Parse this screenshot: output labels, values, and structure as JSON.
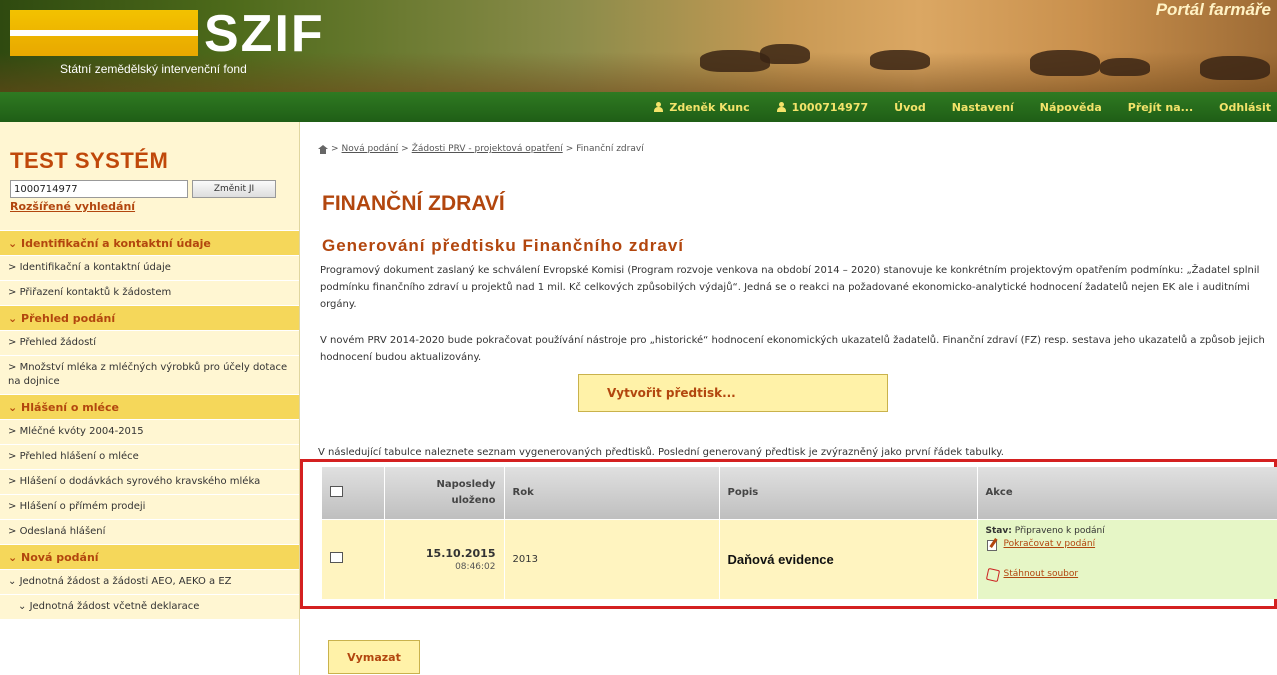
{
  "header": {
    "logo_text": "SZIF",
    "logo_subtitle": "Státní zemědělský intervenční fond",
    "portal_title": "Portál farmáře"
  },
  "topnav": {
    "user_name": "Zdeněk Kunc",
    "user_id": "1000714977",
    "home": "Úvod",
    "settings": "Nastavení",
    "help": "Nápověda",
    "goto": "Přejít na...",
    "logout": "Odhlásit"
  },
  "sidebar": {
    "title": "TEST SYSTÉM",
    "search_value": "1000714977",
    "search_button": "Změnit JI",
    "advanced_search": "Rozšířené vyhledání",
    "sections": [
      {
        "label": "Identifikační a kontaktní údaje",
        "items": [
          "Identifikační a kontaktní údaje",
          "Přiřazení kontaktů k žádostem"
        ]
      },
      {
        "label": "Přehled podání",
        "items": [
          "Přehled žádostí",
          "Množství mléka z mléčných výrobků pro účely dotace na dojnice"
        ]
      },
      {
        "label": "Hlášení o mléce",
        "items": [
          "Mléčné kvóty 2004-2015",
          "Přehled hlášení o mléce",
          "Hlášení o dodávkách syrového kravského mléka",
          "Hlášení o přímém prodeji",
          "Odeslaná hlášení"
        ]
      },
      {
        "label": "Nová podání",
        "items": [
          "Jednotná žádost a žádosti AEO, AEKO a EZ",
          "Jednotná žádost včetně deklarace"
        ]
      }
    ]
  },
  "main": {
    "breadcrumb": [
      "Nová podání",
      "Žádosti PRV - projektová opatření",
      "Finanční zdraví"
    ],
    "page_title": "FINANČNÍ ZDRAVÍ",
    "section_title": "Generování předtisku Finančního zdraví",
    "paragraph1": "Programový dokument zaslaný ke schválení Evropské Komisi (Program rozvoje venkova na období 2014 – 2020) stanovuje ke konkrétním projektovým opatřením podmínku: „Žadatel splnil podmínku finančního zdraví u projektů nad 1 mil. Kč celkových způsobilých výdajů“. Jedná se o reakci na požadované ekonomicko-analytické hodnocení žadatelů nejen EK ale i auditními orgány.",
    "paragraph2": "V novém PRV 2014-2020 bude pokračovat používání nástroje pro „historické“ hodnocení ekonomických ukazatelů žadatelů. Finanční zdraví (FZ) resp. sestava jeho ukazatelů a způsob jejich hodnocení budou aktualizovány.",
    "create_button": "Vytvořit předtisk...",
    "table_note": "V následující tabulce naleznete seznam vygenerovaných předtisků. Poslední generovaný předtisk je zvýrazněný jako první řádek tabulky.",
    "table": {
      "headers": [
        "",
        "Naposledy uloženo",
        "Rok",
        "Popis",
        "Akce"
      ],
      "rows": [
        {
          "date": "15.10.2015",
          "time": "08:46:02",
          "year": "2013",
          "description": "Daňová evidence",
          "state_label": "Stav:",
          "state_value": "Připraveno k podání",
          "continue_link": "Pokračovat v podání",
          "download_link": "Stáhnout soubor"
        }
      ]
    },
    "delete_button": "Vymazat"
  },
  "colors": {
    "accent": "#b2460e",
    "nav_green": "#2f7a22",
    "sidebar_yellow": "#f5d75a",
    "highlight_red": "#d42020"
  }
}
